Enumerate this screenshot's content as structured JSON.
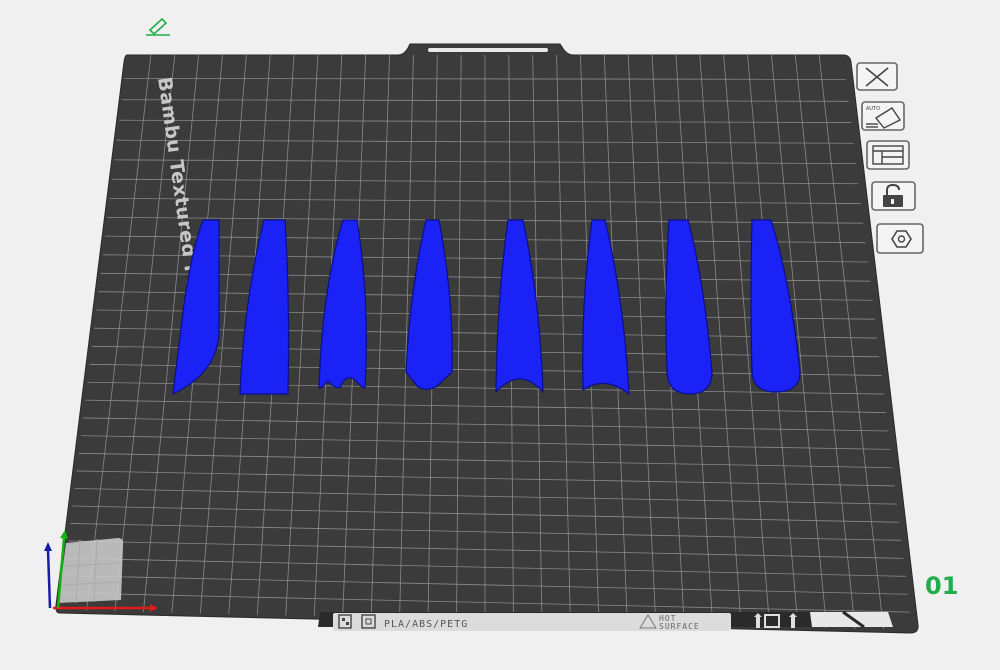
{
  "plate": {
    "name": "Bambu Textured PEI Plate",
    "number": "01",
    "materials": "PLA/ABS/PETG",
    "hot_surface_line1": "HOT",
    "hot_surface_line2": "SURFACE"
  },
  "toolbar": {
    "buttons": [
      {
        "name": "close-plate",
        "icon": "close-icon"
      },
      {
        "name": "auto-orient",
        "icon": "auto-orient-icon",
        "label": "AUTO"
      },
      {
        "name": "arrange",
        "icon": "arrange-icon"
      },
      {
        "name": "lock-plate",
        "icon": "unlock-icon"
      },
      {
        "name": "plate-settings",
        "icon": "gear-hex-icon"
      }
    ]
  },
  "objects": {
    "count": 8,
    "color": "#1a22f5"
  },
  "colors": {
    "background": "#f0f0f0",
    "plate": "#3b3b3b",
    "grid": "#8a8a8a",
    "object": "#1a22f5",
    "plate_number": "#1fae4b",
    "edit_icon": "#1fae4b"
  }
}
